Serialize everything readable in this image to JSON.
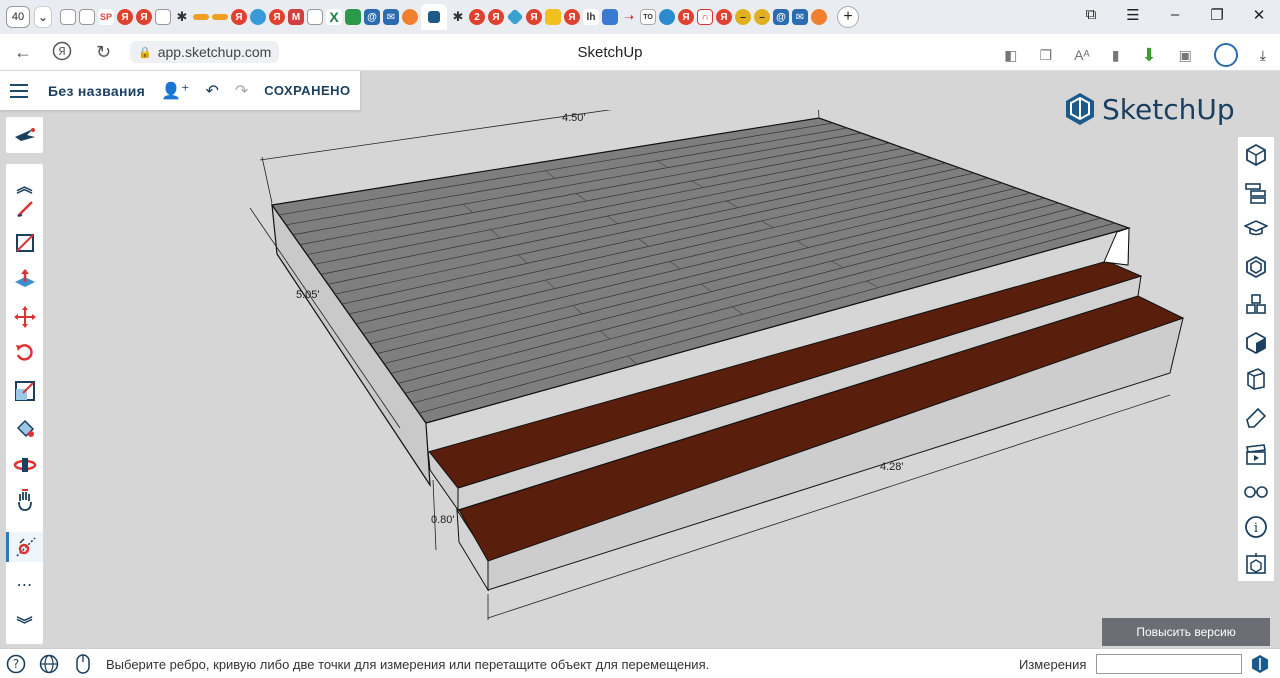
{
  "browser": {
    "tab_count": "40",
    "url": "app.sketchup.com",
    "page_title": "SketchUp"
  },
  "app": {
    "document_title": "Без названия",
    "save_status": "СОХРАНЕНО",
    "logo_text": "SketchUp",
    "upgrade_button": "Повысить версию"
  },
  "model": {
    "dimensions": {
      "top_length": "4.50'",
      "side_depth": "5.05'",
      "front_length": "4.28'",
      "step_height": "0.80'"
    },
    "colors": {
      "background": "#d6d6d6",
      "deck_planks": "#7e7e7e",
      "step_tread": "#5a1e0c",
      "side_faces": "#c8c8c8",
      "accent": "#1b3f5e"
    }
  },
  "left_toolbar": {
    "tools": [
      "select",
      "collapse-up",
      "line",
      "rectangle",
      "push-pull",
      "move",
      "rotate",
      "scale",
      "paint-bucket",
      "orbit",
      "pan",
      "tape-measure",
      "more",
      "expand-down"
    ]
  },
  "right_panel": {
    "tools": [
      "entity-info",
      "outliner",
      "instructor",
      "components",
      "materials",
      "styles",
      "layers",
      "eraser",
      "scenes",
      "display",
      "info",
      "shadows"
    ]
  },
  "statusbar": {
    "message": "Выберите ребро, кривую либо две точки для измерения или перетащите объект для перемещения.",
    "measurements_label": "Измерения",
    "measurements_value": ""
  }
}
